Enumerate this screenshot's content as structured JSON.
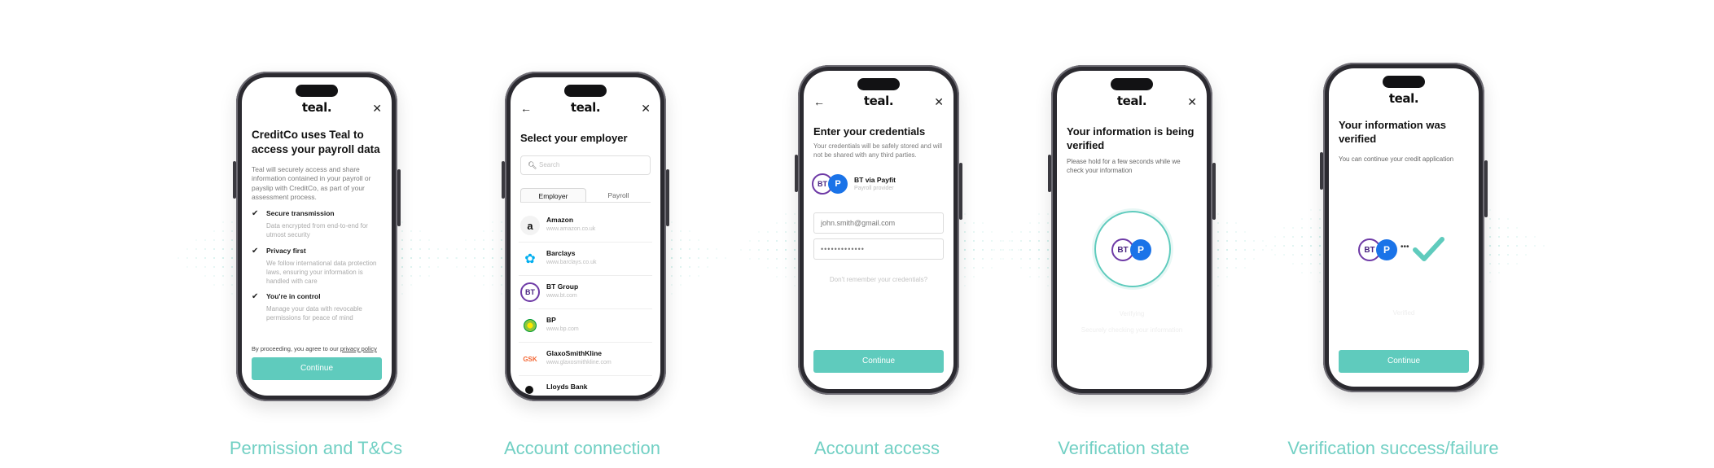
{
  "brand": {
    "logo": "teal.",
    "accent": "#5fcbbd",
    "caption_color": "#72d0c4"
  },
  "screens": {
    "permission": {
      "title": "CreditCo uses Teal to access your payroll data",
      "intro": "Teal will securely access and share information contained in your payroll or payslip with CreditCo, as part of your assessment process.",
      "items": [
        {
          "title": "Secure transmission",
          "desc": "Data encrypted from end-to-end for utmost security"
        },
        {
          "title": "Privacy first",
          "desc": "We follow international data protection laws, ensuring your information is handled with care"
        },
        {
          "title": "You're in control",
          "desc": "Manage your data with revocable permissions for peace of mind"
        }
      ],
      "consent_prefix": "By proceeding, you agree to our",
      "consent_link": "privacy policy",
      "button": "Continue"
    },
    "employer": {
      "title": "Select your employer",
      "search_placeholder": "Search",
      "tabs": [
        "Employer",
        "Payroll"
      ],
      "employers": [
        {
          "name": "Amazon",
          "url": "www.amazon.co.uk",
          "logo": "a"
        },
        {
          "name": "Barclays",
          "url": "www.barclays.co.uk",
          "logo": "🦅"
        },
        {
          "name": "BT Group",
          "url": "www.bt.com",
          "logo": "BT"
        },
        {
          "name": "BP",
          "url": "www.bp.com",
          "logo": "●"
        },
        {
          "name": "GlaxoSmithKline",
          "url": "www.glaxosmithkline.com",
          "logo": "GSK"
        },
        {
          "name": "Lloyds Bank",
          "url": "",
          "logo": ""
        }
      ]
    },
    "credentials": {
      "title": "Enter your credentials",
      "intro": "Your credentials will be safely stored and will not be shared with any third parties.",
      "provider_name": "BT via Payfit",
      "provider_sub": "Payroll provider",
      "email_value": "john.smith@gmail.com",
      "password_value": "•••••••••••••",
      "forgot": "Don't remember your credentials?",
      "button": "Continue",
      "bt_label": "BT",
      "payfit_label": "P"
    },
    "verifying": {
      "title": "Your information is being verified",
      "intro": "Please hold for a few seconds while we check your information",
      "status": "Verifying",
      "status_sub": "Securely checking your information",
      "bt_label": "BT",
      "payfit_label": "P"
    },
    "verified": {
      "title": "Your information was verified",
      "intro": "You can continue your credit application",
      "status": "Verified",
      "dots": "•••",
      "button": "Continue",
      "bt_label": "BT",
      "payfit_label": "P"
    }
  },
  "captions": [
    "Permission and T&Cs",
    "Account connection",
    "Account access",
    "Verification state",
    "Verification success/failure"
  ],
  "icons": {
    "close": "close-icon",
    "back": "back-arrow-icon",
    "search": "search-icon",
    "check": "check-icon"
  }
}
